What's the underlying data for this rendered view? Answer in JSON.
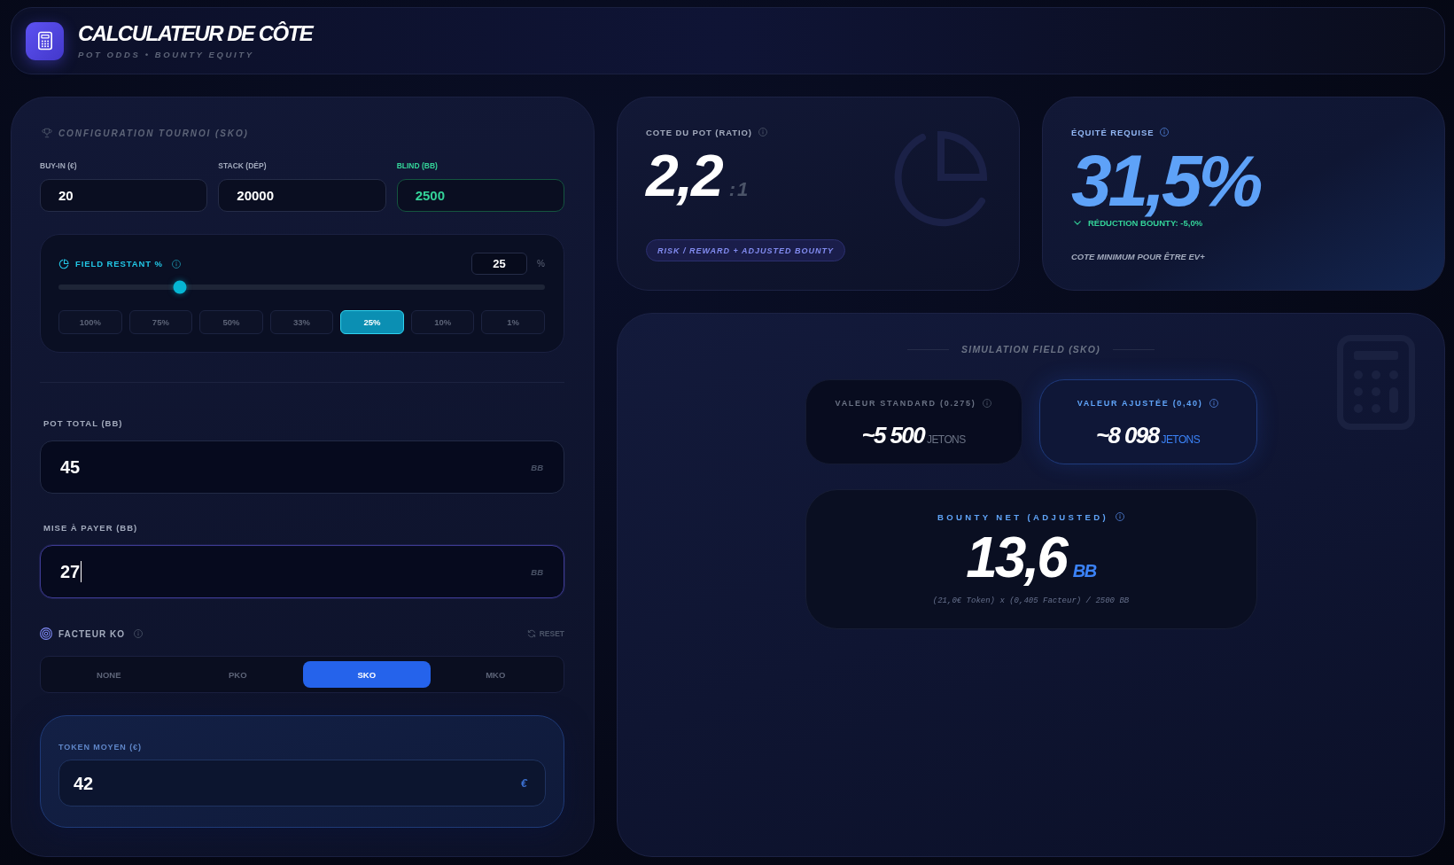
{
  "header": {
    "title": "CALCULATEUR DE CÔTE",
    "subtitle": "POT ODDS • BOUNTY EQUITY"
  },
  "config": {
    "title": "CONFIGURATION TOURNOI (SKO)",
    "fields": [
      {
        "label": "BUY-IN (€)",
        "value": "20",
        "highlighted": false
      },
      {
        "label": "STACK (DÉP)",
        "value": "20000",
        "highlighted": false
      },
      {
        "label": "BLIND (BB)",
        "value": "2500",
        "highlighted": true
      }
    ],
    "field_remaining": {
      "label": "FIELD RESTANT %",
      "value": "25",
      "unit": "%",
      "level": 0.25,
      "presets": [
        {
          "label": "100%",
          "selected": false
        },
        {
          "label": "75%",
          "selected": false
        },
        {
          "label": "50%",
          "selected": false
        },
        {
          "label": "33%",
          "selected": false
        },
        {
          "label": "25%",
          "selected": true
        },
        {
          "label": "10%",
          "selected": false
        },
        {
          "label": "1%",
          "selected": false
        }
      ]
    }
  },
  "pot_total": {
    "label": "POT TOTAL (BB)",
    "value": "45",
    "unit": "BB",
    "focused": false
  },
  "bet_to_call": {
    "label": "MISE À PAYER (BB)",
    "value": "27",
    "unit": "BB",
    "focused": true
  },
  "ko_factor": {
    "label": "FACTEUR KO",
    "reset": "RESET",
    "options": [
      {
        "label": "NONE",
        "selected": false
      },
      {
        "label": "PKO",
        "selected": false
      },
      {
        "label": "SKO",
        "selected": true
      },
      {
        "label": "MKO",
        "selected": false
      }
    ]
  },
  "average_token": {
    "label": "TOKEN MOYEN (€)",
    "value": "42",
    "unit": "€"
  },
  "pot_odds": {
    "label": "COTE DU POT (RATIO)",
    "value": "2,2",
    "suffix": ":1",
    "badge": "RISK / REWARD + ADJUSTED BOUNTY"
  },
  "required_equity": {
    "label": "ÉQUITÉ REQUISE",
    "value": "31,5%",
    "reduction": "RÉDUCTION BOUNTY: -5,0%",
    "note": "COTE MINIMUM POUR ÊTRE EV+"
  },
  "simulation": {
    "title": "SIMULATION FIELD (SKO)",
    "values": [
      {
        "label": "VALEUR STANDARD (0.275)",
        "value": "~5 500",
        "unit": "JETONS",
        "highlighted": false
      },
      {
        "label": "VALEUR AJUSTÉE (0,40)",
        "value": "~8 098",
        "unit": "JETONS",
        "highlighted": true
      }
    ],
    "bounty": {
      "label": "BOUNTY NET (ADJUSTED)",
      "value": "13,6",
      "unit": "BB",
      "formula": "(21,0€ Token) x (0,405 Facteur) / 2500 BB"
    }
  }
}
